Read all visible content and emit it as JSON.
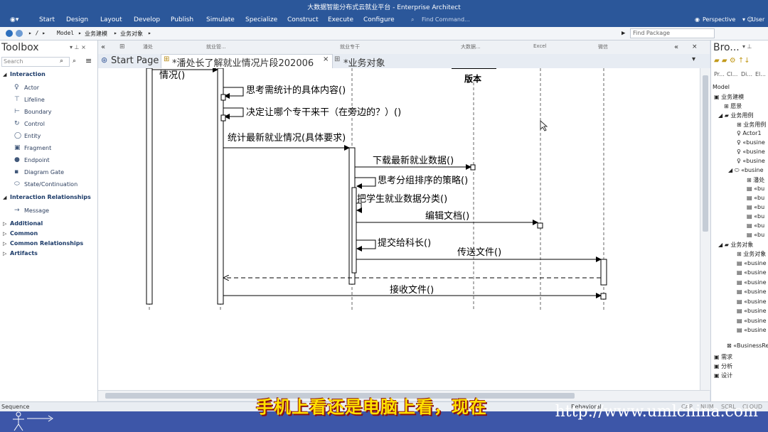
{
  "window": {
    "title": "大数据智能分布式云就业平台 - Enterprise Architect"
  },
  "ribbon": {
    "tabs": [
      "Start",
      "Design",
      "Layout",
      "Develop",
      "Publish",
      "Simulate",
      "Specialize",
      "Construct",
      "Execute",
      "Configure"
    ],
    "find_command": "Find Command...",
    "perspective": "Perspective",
    "user": "User"
  },
  "breadcrumb": {
    "items": [
      "Model",
      "业务建模",
      "业务对象"
    ],
    "find_package": "Find Package"
  },
  "toolbox": {
    "title": "Toolbox",
    "search_placeholder": "Search",
    "section_interaction": "Interaction",
    "items": [
      "Actor",
      "Lifeline",
      "Boundary",
      "Control",
      "Entity",
      "Fragment",
      "Endpoint",
      "Diagram Gate",
      "State/Continuation"
    ],
    "section_relationships": "Interaction Relationships",
    "rel_items": [
      "Message"
    ],
    "collapsed": [
      "Additional",
      "Common",
      "Common Relationships",
      "Artifacts"
    ]
  },
  "doc_tabs": [
    "Start Page",
    "*潘处长了解就业情况片段202006",
    "*业务对象"
  ],
  "lane_headers": [
    "潘处",
    "就业管...",
    "就业专干",
    "大数据...",
    "Excel",
    "微信"
  ],
  "diagram": {
    "partial_label_left": "情况()",
    "partial_header": "版本",
    "messages": [
      "思考需统计的具体内容()",
      "决定让哪个专干来干（在旁边的？）()",
      "统计最新就业情况(具体要求)",
      "下载最新就业数据()",
      "思考分组排序的策略()",
      "把学生就业数据分类()",
      "编辑文档()",
      "提交给科长()",
      "传送文件()",
      "接收文件()"
    ]
  },
  "browser": {
    "title": "Bro...",
    "tabs": [
      "Pr...",
      "Cl...",
      "Di...",
      "El..."
    ],
    "items": [
      "Model",
      "业务建模",
      "愿景",
      "业务用例",
      "业务用例",
      "Actor1",
      "«busine",
      "«busine",
      "«busine",
      "«busine",
      "潘处",
      "«bu",
      "«bu",
      "«bu",
      "«bu",
      "«bu",
      "«bu",
      "业务对象",
      "业务对象",
      "«busine",
      "«busine",
      "«busine",
      "«busine",
      "«busine",
      "«busine",
      "«busine",
      "«busine",
      "«BusinessRe",
      "需求",
      "分析",
      "设计"
    ]
  },
  "status": {
    "left": "Sequence",
    "mode": "Behavioral",
    "keys": [
      "CAP",
      "NUM",
      "SCRL",
      "CLOUD"
    ]
  },
  "overlay": {
    "subtitle": "手机上看还是电脑上看，现在",
    "site": "http://www.umlchina.com"
  }
}
